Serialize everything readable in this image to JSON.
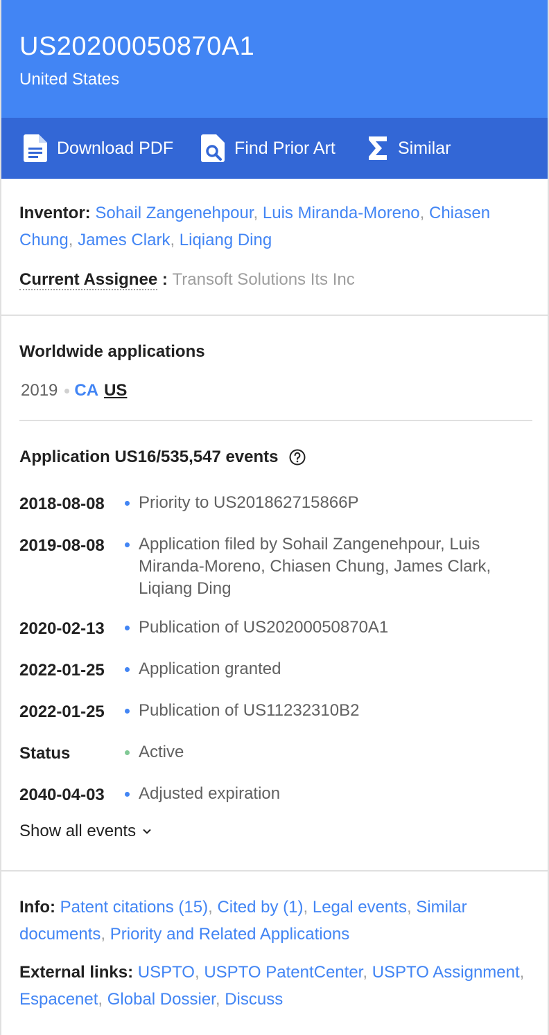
{
  "header": {
    "publication_number": "US20200050870A1",
    "country": "United States"
  },
  "actions": {
    "download_pdf": "Download PDF",
    "find_prior_art": "Find Prior Art",
    "similar": "Similar"
  },
  "people": {
    "inventor_label": "Inventor:",
    "inventors": [
      "Sohail Zangenehpour",
      "Luis Miranda-Moreno",
      "Chiasen Chung",
      "James Clark",
      "Liqiang Ding"
    ],
    "assignee_label": "Current Assignee",
    "assignee_colon": " : ",
    "assignee": "Transoft Solutions Its Inc"
  },
  "worldwide": {
    "title": "Worldwide applications",
    "year": "2019",
    "countries": [
      "CA",
      "US"
    ]
  },
  "events": {
    "title": "Application US16/535,547 events",
    "items": [
      {
        "date": "2018-08-08",
        "text": "Priority to US201862715866P",
        "status": "blue"
      },
      {
        "date": "2019-08-08",
        "text": "Application filed by Sohail Zangenehpour, Luis Miranda-Moreno, Chiasen Chung, James Clark, Liqiang Ding",
        "status": "blue"
      },
      {
        "date": "2020-02-13",
        "text": "Publication of US20200050870A1",
        "status": "blue"
      },
      {
        "date": "2022-01-25",
        "text": "Application granted",
        "status": "blue"
      },
      {
        "date": "2022-01-25",
        "text": "Publication of US11232310B2",
        "status": "blue"
      },
      {
        "date": "Status",
        "text": "Active",
        "status": "green"
      },
      {
        "date": "2040-04-03",
        "text": "Adjusted expiration",
        "status": "blue"
      }
    ],
    "show_all": "Show all events"
  },
  "info": {
    "label": "Info:",
    "links": [
      "Patent citations (15)",
      "Cited by (1)",
      "Legal events",
      "Similar documents",
      "Priority and Related Applications"
    ]
  },
  "external": {
    "label": "External links:",
    "links": [
      "USPTO",
      "USPTO PatentCenter",
      "USPTO Assignment",
      "Espacenet",
      "Global Dossier",
      "Discuss"
    ]
  },
  "colors": {
    "header_bg": "#4285f4",
    "toolbar_bg": "#3367d6",
    "link": "#4285f4",
    "active_status": "#81c995"
  }
}
